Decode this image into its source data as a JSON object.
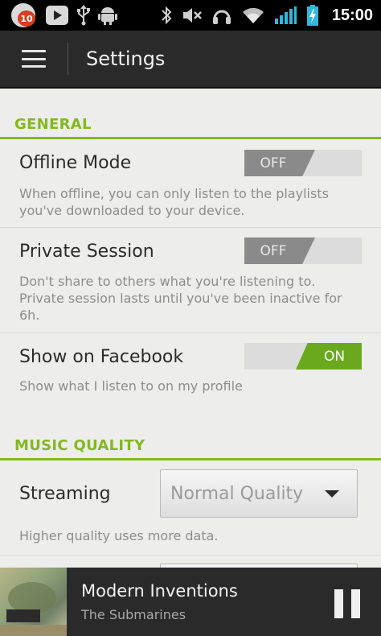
{
  "status_bar": {
    "notification_count": "10",
    "time": "15:00",
    "icons": [
      "notification-badge-icon",
      "video-icon",
      "usb-icon",
      "android-debug-icon",
      "bluetooth-icon",
      "mute-icon",
      "headphones-icon",
      "wifi-icon",
      "signal-icon",
      "battery-charging-icon"
    ]
  },
  "action_bar": {
    "title": "Settings",
    "menu_icon": "hamburger-menu-icon"
  },
  "sections": {
    "general": {
      "header": "GENERAL",
      "offline_mode": {
        "title": "Offline Mode",
        "description_line1": "When offline, you can only listen to the playlists",
        "description_line2": "you've downloaded to your device.",
        "toggle_label": "OFF",
        "state": "off"
      },
      "private_session": {
        "title": "Private Session",
        "description_line1": "Don't share to others what you're listening to.",
        "description_line2": "Private session lasts until you've been inactive for",
        "description_line3": "6h.",
        "toggle_label": "OFF",
        "state": "off"
      },
      "show_on_facebook": {
        "title": "Show on Facebook",
        "description_line1": "Show what I listen to on my profile",
        "toggle_label": "ON",
        "state": "on"
      }
    },
    "music_quality": {
      "header": "MUSIC QUALITY",
      "streaming": {
        "title": "Streaming",
        "selected": "Normal Quality",
        "description_line1": "Higher quality uses more data."
      }
    }
  },
  "now_playing": {
    "track": "Modern Inventions",
    "artist": "The Submarines",
    "control_icon": "pause-icon"
  },
  "colors": {
    "accent_green": "#84b820",
    "toggle_on": "#6aa81e",
    "toggle_off": "#8a8a8a",
    "action_bar": "#2a2a2a"
  }
}
